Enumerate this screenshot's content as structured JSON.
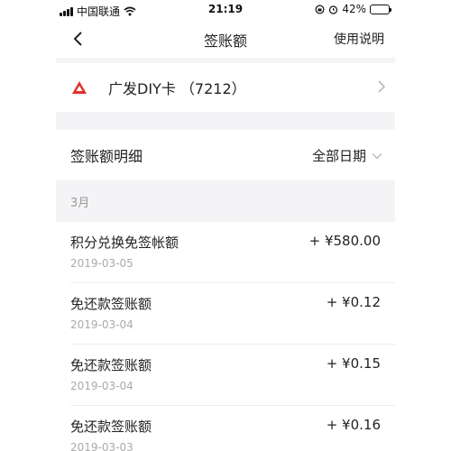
{
  "status_bar": {
    "carrier": "中国联通",
    "time": "21:19",
    "battery": "42%",
    "battery_level": 0.42
  },
  "nav": {
    "title": "签账额",
    "help": "使用说明"
  },
  "card": {
    "name": "广发DIY卡  （7212）",
    "logo_color": "#e0302a"
  },
  "detail": {
    "title": "签账额明细",
    "filter": "全部日期"
  },
  "month": "3月",
  "transactions": [
    {
      "name": "积分兑换免签帐额",
      "date": "2019-03-05",
      "amount": "+ ¥580.00"
    },
    {
      "name": "免还款签账额",
      "date": "2019-03-04",
      "amount": "+ ¥0.12"
    },
    {
      "name": "免还款签账额",
      "date": "2019-03-04",
      "amount": "+ ¥0.15"
    },
    {
      "name": "免还款签账额",
      "date": "2019-03-03",
      "amount": "+ ¥0.16"
    }
  ]
}
